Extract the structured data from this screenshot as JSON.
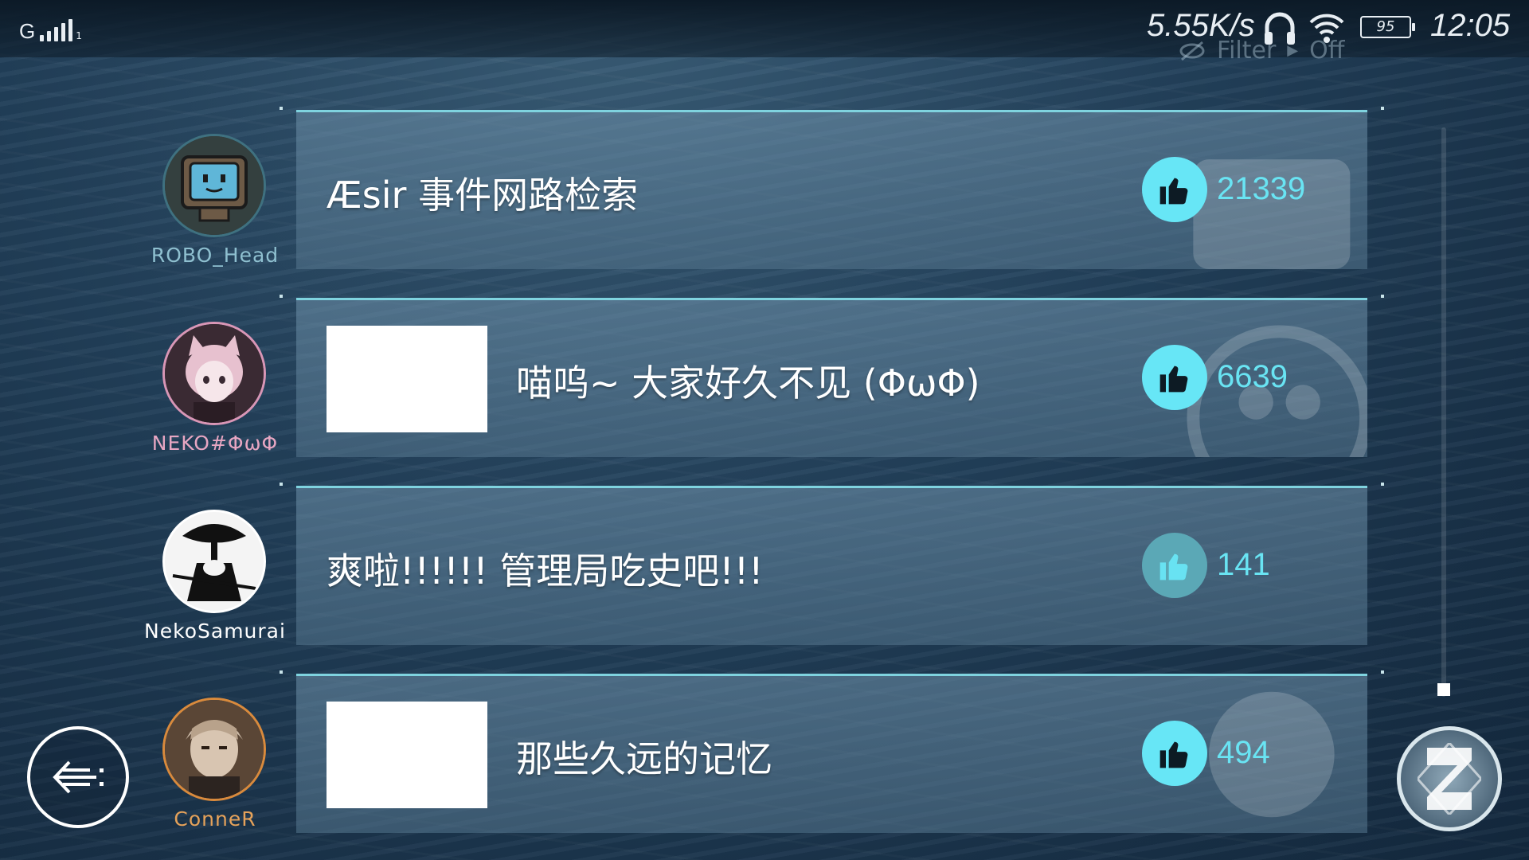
{
  "status_bar": {
    "signal_label": "G",
    "signal_sub": "1",
    "net_speed": "5.55K/s",
    "battery": "95",
    "time": "12:05"
  },
  "filter": {
    "label": "Filter",
    "state": "Off",
    "icon": "eye-off-icon"
  },
  "posts": [
    {
      "username": "ROBO_Head",
      "username_color": "#8fc0d0",
      "title": "Æsir 事件网路检索",
      "has_image": false,
      "likes": "21339",
      "liked": true
    },
    {
      "username": "NEKO#ΦωΦ",
      "username_color": "#e7a6c2",
      "title": "喵呜~ 大家好久不见 (ΦωΦ)",
      "has_image": true,
      "likes": "6639",
      "liked": true
    },
    {
      "username": "NekoSamurai",
      "username_color": "#ffffff",
      "title": "爽啦!!!!!! 管理局吃史吧!!!",
      "has_image": false,
      "likes": "141",
      "liked": false
    },
    {
      "username": "ConneR",
      "username_color": "#e5a25a",
      "title": "那些久远的记忆",
      "has_image": true,
      "likes": "494",
      "liked": true
    }
  ],
  "colors": {
    "accent": "#67e6f6",
    "card_border": "#7fd3df"
  },
  "icons": {
    "like": "thumbs-up-icon",
    "back": "back-arrow-icon",
    "emblem": "emblem-icon"
  }
}
